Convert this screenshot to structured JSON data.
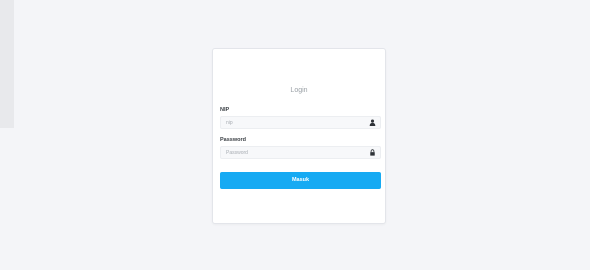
{
  "login": {
    "title": "Login",
    "nip_label": "NIP",
    "nip_placeholder": "nip",
    "password_label": "Password",
    "password_placeholder": "Password",
    "submit_label": "Masuk"
  },
  "icons": {
    "nip": "user-icon",
    "password": "lock-icon"
  },
  "colors": {
    "background": "#f4f5f8",
    "card": "#ffffff",
    "button": "#16aaf3",
    "button_text": "#ffffff"
  }
}
